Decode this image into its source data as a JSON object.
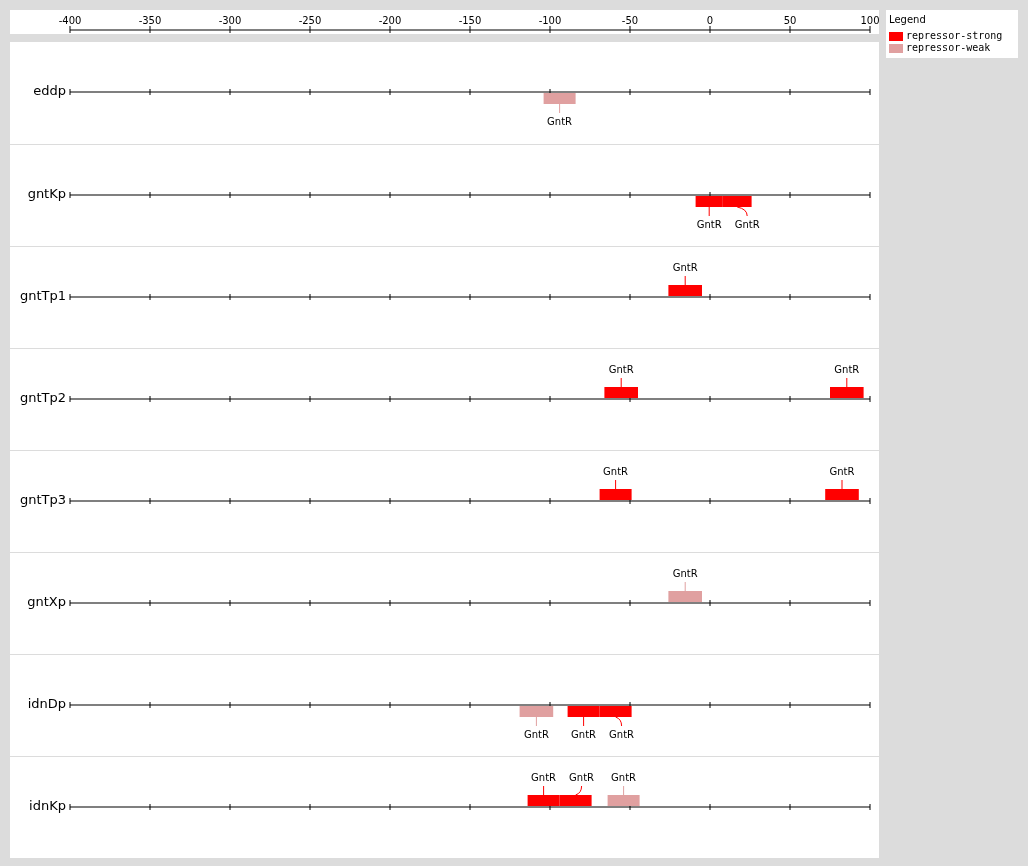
{
  "axis": {
    "ticks": [
      "-400",
      "-350",
      "-300",
      "-250",
      "-200",
      "-150",
      "-100",
      "-50",
      "0",
      "50",
      "100"
    ]
  },
  "legend": {
    "title": "Legend",
    "items": [
      {
        "label": "repressor-strong",
        "kind": "strong"
      },
      {
        "label": "repressor-weak",
        "kind": "weak"
      }
    ]
  },
  "promoters": [
    {
      "name": "eddp",
      "sites": [
        {
          "label": "GntR",
          "kind": "weak"
        }
      ]
    },
    {
      "name": "gntKp",
      "sites": [
        {
          "label": "GntR",
          "kind": "strong"
        },
        {
          "label": "GntR",
          "kind": "strong"
        }
      ]
    },
    {
      "name": "gntTp1",
      "sites": [
        {
          "label": "GntR",
          "kind": "strong"
        }
      ]
    },
    {
      "name": "gntTp2",
      "sites": [
        {
          "label": "GntR",
          "kind": "strong"
        },
        {
          "label": "GntR",
          "kind": "strong"
        }
      ]
    },
    {
      "name": "gntTp3",
      "sites": [
        {
          "label": "GntR",
          "kind": "strong"
        },
        {
          "label": "GntR",
          "kind": "strong"
        }
      ]
    },
    {
      "name": "gntXp",
      "sites": [
        {
          "label": "GntR",
          "kind": "weak"
        }
      ]
    },
    {
      "name": "idnDp",
      "sites": [
        {
          "label": "GntR",
          "kind": "weak"
        },
        {
          "label": "GntR",
          "kind": "strong"
        },
        {
          "label": "GntR",
          "kind": "strong"
        }
      ]
    },
    {
      "name": "idnKp",
      "sites": [
        {
          "label": "GntR",
          "kind": "strong"
        },
        {
          "label": "GntR",
          "kind": "strong"
        },
        {
          "label": "GntR",
          "kind": "weak"
        }
      ]
    }
  ]
}
